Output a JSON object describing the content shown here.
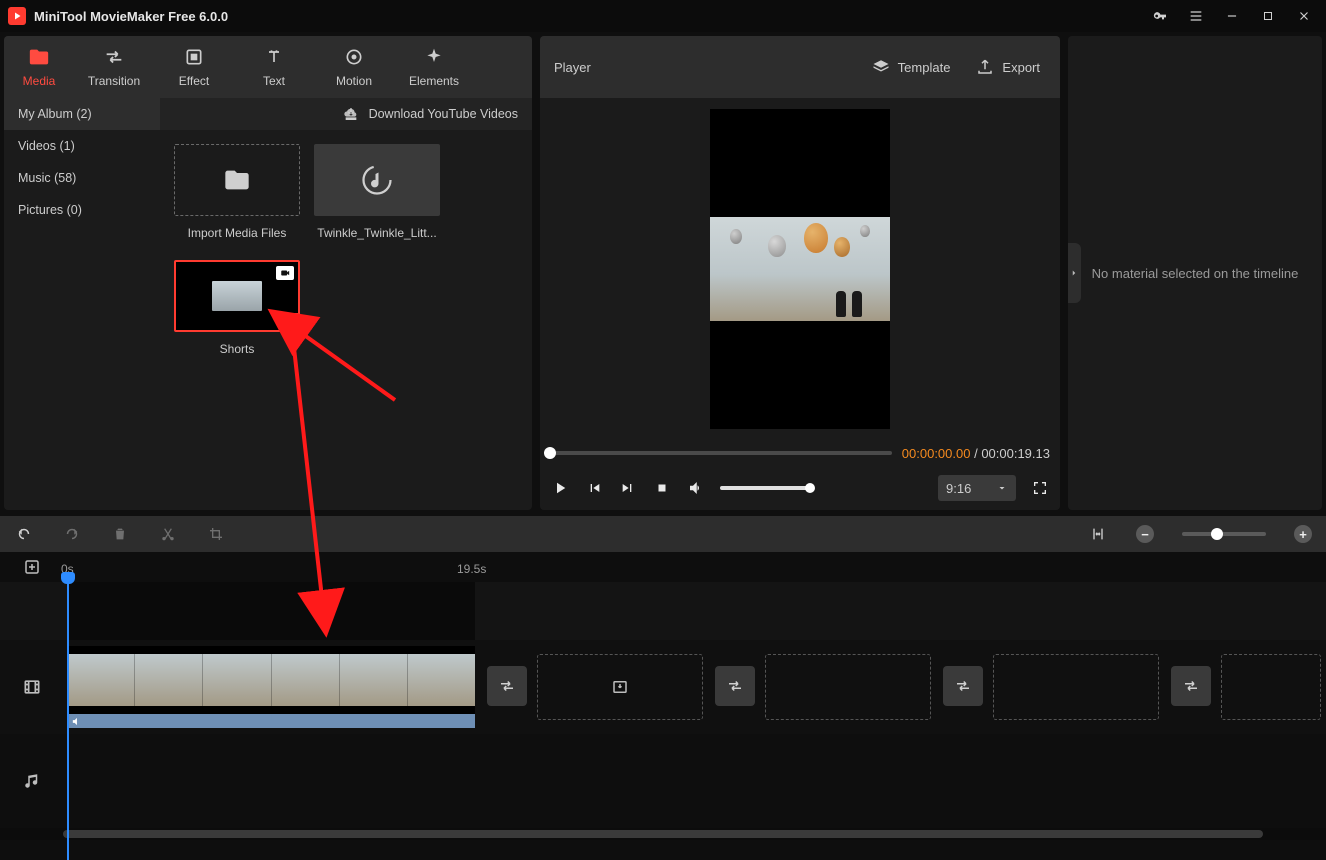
{
  "app": {
    "title": "MiniTool MovieMaker Free 6.0.0"
  },
  "tabs": {
    "media": {
      "label": "Media"
    },
    "transition": {
      "label": "Transition"
    },
    "effect": {
      "label": "Effect"
    },
    "text": {
      "label": "Text"
    },
    "motion": {
      "label": "Motion"
    },
    "elements": {
      "label": "Elements"
    }
  },
  "sidebar": {
    "items": [
      {
        "label": "My Album (2)"
      },
      {
        "label": "Videos (1)"
      },
      {
        "label": "Music (58)"
      },
      {
        "label": "Pictures (0)"
      }
    ]
  },
  "media_toolbar": {
    "download_label": "Download YouTube Videos"
  },
  "media_items": {
    "import": {
      "label": "Import Media Files"
    },
    "audio": {
      "label": "Twinkle_Twinkle_Litt..."
    },
    "video": {
      "label": "Shorts"
    }
  },
  "player": {
    "title": "Player",
    "template_label": "Template",
    "export_label": "Export",
    "time_current": "00:00:00.00",
    "time_sep": " / ",
    "time_total": "00:00:19.13",
    "ratio": "9:16"
  },
  "inspector": {
    "empty": "No material selected on the timeline"
  },
  "timeline": {
    "ruler": {
      "t0": "0s",
      "t1": "19.5s"
    }
  }
}
